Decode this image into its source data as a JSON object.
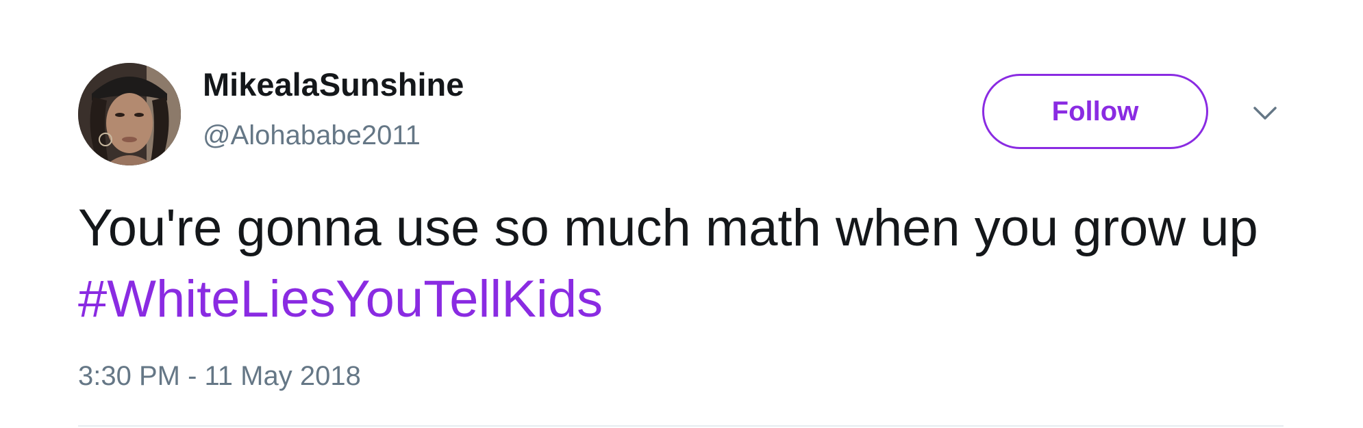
{
  "tweet": {
    "user": {
      "display_name": "MikealaSunshine",
      "handle": "@Alohababe2011",
      "avatar_icon": "profile-photo"
    },
    "follow_label": "Follow",
    "menu_icon": "chevron-down-icon",
    "text": "You're gonna use so much math when you grow up ",
    "hashtag": "#WhiteLiesYouTellKids",
    "timestamp": "3:30 PM - 11 May 2018"
  },
  "colors": {
    "accent": "#8a2be2",
    "text_primary": "#14171a",
    "text_secondary": "#657786",
    "divider": "#e6ecf0"
  }
}
